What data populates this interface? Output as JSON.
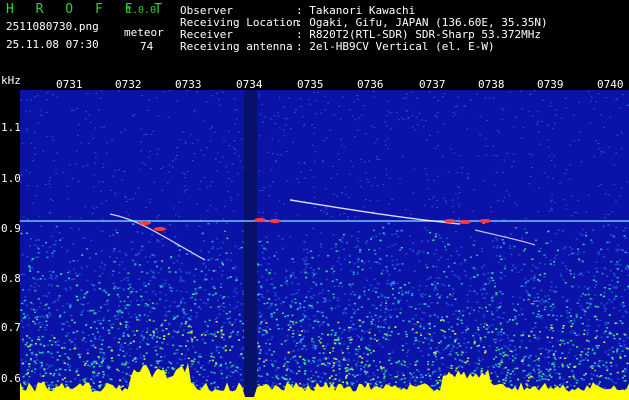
{
  "app": {
    "name": "H R O F F T",
    "version": "1.0.0"
  },
  "file": {
    "name": "2511080730.png",
    "datetime": "25.11.08 07:30"
  },
  "meteor": {
    "label": "meteor",
    "count": "74"
  },
  "station": {
    "observer_label": "Observer",
    "observer": ": Takanori Kawachi",
    "location_label": "Receiving Location",
    "location": ": Ogaki, Gifu, JAPAN (136.60E, 35.35N)",
    "receiver_label": "Receiver",
    "receiver": ": R820T2(RTL-SDR) SDR-Sharp 53.372MHz",
    "antenna_label": "Receiving antenna",
    "antenna": ": 2el-HB9CV Vertical (el. E-W)"
  },
  "axis": {
    "y_unit": "kHz",
    "time_ticks": [
      "0731",
      "0732",
      "0733",
      "0734",
      "0735",
      "0736",
      "0737",
      "0738",
      "0739",
      "0740"
    ],
    "freq_ticks": [
      "1.1",
      "1.0",
      "0.9",
      "0.8",
      "0.7",
      "0.6"
    ]
  },
  "colors": {
    "background": "#0b12a8",
    "text": "#ffffff",
    "title": "#2fd12f",
    "signal": "#ff3b3b",
    "activity": "#ffff00"
  }
}
